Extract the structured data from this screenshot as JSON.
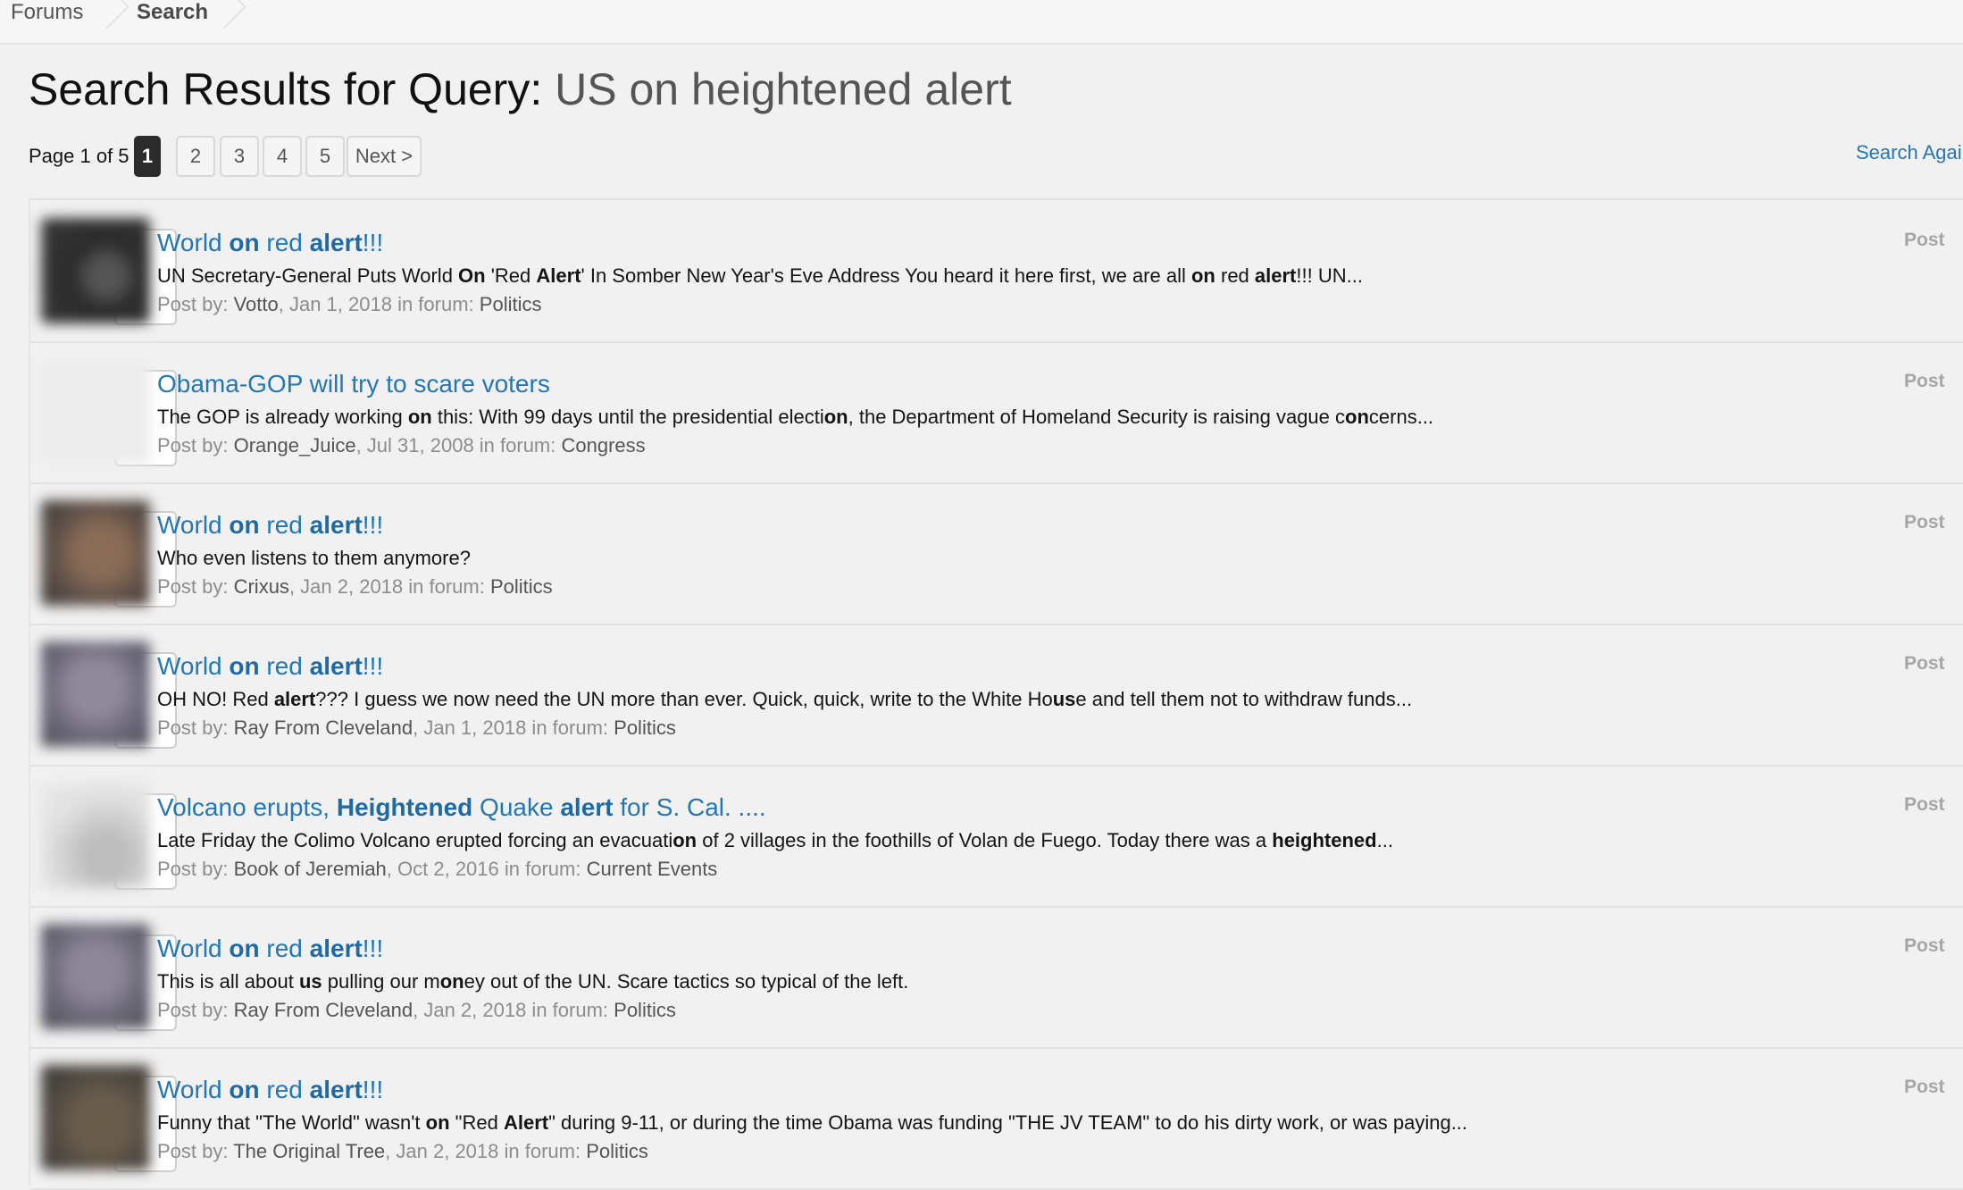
{
  "breadcrumb": {
    "home": "Forums",
    "current": "Search"
  },
  "title": {
    "prefix": "Search Results for Query:",
    "query": "US on heightened alert"
  },
  "pager": {
    "label": "Page 1 of 5",
    "pages": [
      "1",
      "2",
      "3",
      "4",
      "5"
    ],
    "next": "Next >"
  },
  "search_again": "Search Again",
  "results": [
    {
      "title_parts": [
        [
          "World ",
          false
        ],
        [
          "on",
          true
        ],
        [
          " red ",
          false
        ],
        [
          "alert",
          true
        ],
        [
          "!!!",
          false
        ]
      ],
      "snippet_parts": [
        [
          "UN Secretary-General Puts World ",
          false
        ],
        [
          "On",
          true
        ],
        [
          " 'Red ",
          false
        ],
        [
          "Alert",
          true
        ],
        [
          "' In Somber New Year's Eve Address You heard it here first, we are all ",
          false
        ],
        [
          "on",
          true
        ],
        [
          " red ",
          false
        ],
        [
          "alert",
          true
        ],
        [
          "!!! UN...",
          false
        ]
      ],
      "by_label": "Post by: ",
      "author": "Votto",
      "date": ", Jan 1, 2018 in forum: ",
      "forum": "Politics",
      "type": "Post",
      "avatar": "t1"
    },
    {
      "title_parts": [
        [
          "Obama-GOP will try to scare voters",
          false
        ]
      ],
      "snippet_parts": [
        [
          "The GOP is already working ",
          false
        ],
        [
          "on",
          true
        ],
        [
          " this: With 99 days until the presidential electi",
          false
        ],
        [
          "on",
          true
        ],
        [
          ", the Department of Homeland Security is raising vague c",
          false
        ],
        [
          "on",
          true
        ],
        [
          "cerns...",
          false
        ]
      ],
      "by_label": "Post by: ",
      "author": "Orange_Juice",
      "date": ", Jul 31, 2008 in forum: ",
      "forum": "Congress",
      "type": "Post",
      "avatar": "t2"
    },
    {
      "title_parts": [
        [
          "World ",
          false
        ],
        [
          "on",
          true
        ],
        [
          " red ",
          false
        ],
        [
          "alert",
          true
        ],
        [
          "!!!",
          false
        ]
      ],
      "snippet_parts": [
        [
          "Who even listens to them anymore?",
          false
        ]
      ],
      "by_label": "Post by: ",
      "author": "Crixus",
      "date": ", Jan 2, 2018 in forum: ",
      "forum": "Politics",
      "type": "Post",
      "avatar": "t3"
    },
    {
      "title_parts": [
        [
          "World ",
          false
        ],
        [
          "on",
          true
        ],
        [
          " red ",
          false
        ],
        [
          "alert",
          true
        ],
        [
          "!!!",
          false
        ]
      ],
      "snippet_parts": [
        [
          "OH NO! Red ",
          false
        ],
        [
          "alert",
          true
        ],
        [
          "??? I guess we now need the UN more than ever. Quick, quick, write to the White Ho",
          false
        ],
        [
          "us",
          true
        ],
        [
          "e and tell them not to withdraw funds...",
          false
        ]
      ],
      "by_label": "Post by: ",
      "author": "Ray From Cleveland",
      "date": ", Jan 1, 2018 in forum: ",
      "forum": "Politics",
      "type": "Post",
      "avatar": "t4"
    },
    {
      "title_parts": [
        [
          "Volcano erupts, ",
          false
        ],
        [
          "Heightened",
          true
        ],
        [
          " Quake ",
          false
        ],
        [
          "alert",
          true
        ],
        [
          " for S. Cal. ....",
          false
        ]
      ],
      "snippet_parts": [
        [
          "Late Friday the Colimo Volcano erupted forcing an evacuati",
          false
        ],
        [
          "on",
          true
        ],
        [
          " of 2 villages in the foothills of Volan de Fuego. Today there was a ",
          false
        ],
        [
          "heightened",
          true
        ],
        [
          "...",
          false
        ]
      ],
      "by_label": "Post by: ",
      "author": "Book of Jeremiah",
      "date": ", Oct 2, 2016 in forum: ",
      "forum": "Current Events",
      "type": "Post",
      "avatar": "t5"
    },
    {
      "title_parts": [
        [
          "World ",
          false
        ],
        [
          "on",
          true
        ],
        [
          " red ",
          false
        ],
        [
          "alert",
          true
        ],
        [
          "!!!",
          false
        ]
      ],
      "snippet_parts": [
        [
          "This is all about ",
          false
        ],
        [
          "us",
          true
        ],
        [
          " pulling our m",
          false
        ],
        [
          "on",
          true
        ],
        [
          "ey out of the UN. Scare tactics so typical of the left.",
          false
        ]
      ],
      "by_label": "Post by: ",
      "author": "Ray From Cleveland",
      "date": ", Jan 2, 2018 in forum: ",
      "forum": "Politics",
      "type": "Post",
      "avatar": "t6"
    },
    {
      "title_parts": [
        [
          "World ",
          false
        ],
        [
          "on",
          true
        ],
        [
          " red ",
          false
        ],
        [
          "alert",
          true
        ],
        [
          "!!!",
          false
        ]
      ],
      "snippet_parts": [
        [
          "Funny that \"The World\" wasn't ",
          false
        ],
        [
          "on",
          true
        ],
        [
          " \"Red ",
          false
        ],
        [
          "Alert",
          true
        ],
        [
          "\" during 9-11, or during the time Obama was funding \"THE JV TEAM\" to do his dirty work, or was paying...",
          false
        ]
      ],
      "by_label": "Post by: ",
      "author": "The Original Tree",
      "date": ", Jan 2, 2018 in forum: ",
      "forum": "Politics",
      "type": "Post",
      "avatar": "t7"
    }
  ]
}
